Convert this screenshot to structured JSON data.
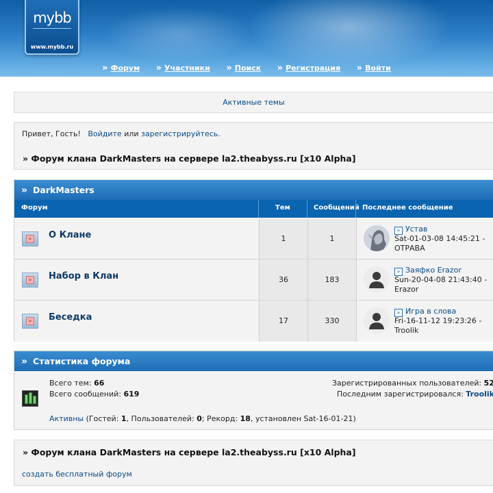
{
  "header": {
    "logo_text": "mybb",
    "logo_url": "www.mybb.ru",
    "nav": [
      {
        "label": "Форум"
      },
      {
        "label": "Участники"
      },
      {
        "label": "Поиск"
      },
      {
        "label": "Регистрация"
      },
      {
        "label": "Войти"
      }
    ]
  },
  "active_topics": "Активные темы",
  "greeting": {
    "hello": "Привет, Гость!",
    "login": "Войдите",
    "or": "или",
    "register": "зарегистрируйтесь."
  },
  "forum_title": "» Форум клана DarkMasters на сервере la2.theabyss.ru [x10 Alpha]",
  "category": {
    "name": "DarkMasters",
    "columns": {
      "forum": "Форум",
      "topics": "Тем",
      "posts": "Сообщений",
      "last": "Последнее сообщение"
    },
    "forums": [
      {
        "name": "О Клане",
        "topics": "1",
        "posts": "1",
        "last_topic": "Устав",
        "last_date": "Sat-01-03-08 14:45:21 -",
        "last_author": "ОТРАВА",
        "avatar": "elf"
      },
      {
        "name": "Набор в Клан",
        "topics": "36",
        "posts": "183",
        "last_topic": "Заяфко Erazor",
        "last_date": "Sun-20-04-08 21:43:40 -",
        "last_author": "Erazor",
        "avatar": "default"
      },
      {
        "name": "Беседка",
        "topics": "17",
        "posts": "330",
        "last_topic": "Игра в слова",
        "last_date": "Fri-16-11-12 19:23:26 -",
        "last_author": "Troolik",
        "avatar": "default"
      }
    ]
  },
  "stats": {
    "title": "Статистика форума",
    "total_topics_label": "Всего тем:",
    "total_topics": "66",
    "total_posts_label": "Всего сообщений:",
    "total_posts": "619",
    "registered_label": "Зарегистрированных пользователей:",
    "registered": "52",
    "last_registered_label": "Последним зарегистрировался:",
    "last_registered": "Troolik",
    "online_link": "Активны",
    "guests_label": "(Гостей:",
    "guests": "1",
    "users_label": ", Пользователей:",
    "users": "0",
    "record_label": "; Рекорд:",
    "record": "18",
    "record_date": ", установлен Sat-16-01-21)"
  },
  "footer": {
    "create_forum": "создать бесплатный форум"
  }
}
